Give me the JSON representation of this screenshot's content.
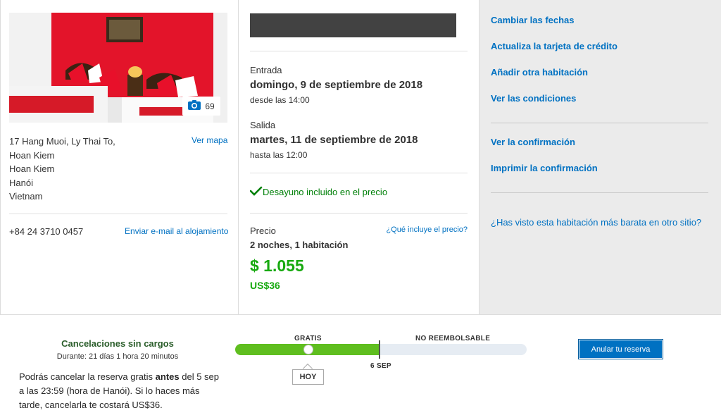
{
  "hotel": {
    "photo_count": "69",
    "address_lines": [
      "17 Hang Muoi, Ly Thai To,",
      "Hoan Kiem",
      "Hoan Kiem",
      "Hanói",
      "Vietnam"
    ],
    "map_link": "Ver mapa",
    "phone": "+84 24 3710 0457",
    "email_link": "Enviar e-mail al alojamiento"
  },
  "booking": {
    "checkin_label": "Entrada",
    "checkin_date": "domingo, 9 de septiembre de 2018",
    "checkin_time": "desde las 14:00",
    "checkout_label": "Salida",
    "checkout_date": "martes, 11 de septiembre de 2018",
    "checkout_time": "hasta las 12:00",
    "breakfast": "Desayuno incluido en el precio",
    "price_label": "Precio",
    "price_question": "¿Qué incluye el precio?",
    "stay_summary": "2 noches, 1 habitación",
    "price_local": "$ 1.055",
    "price_usd": "US$36"
  },
  "actions": {
    "change_dates": "Cambiar las fechas",
    "update_card": "Actualiza la tarjeta de crédito",
    "add_room": "Añadir otra habitación",
    "view_conditions": "Ver las condiciones",
    "view_confirmation": "Ver la confirmación",
    "print_confirmation": "Imprimir la confirmación",
    "cheaper_question": "¿Has visto esta habitación más barata en otro sitio?"
  },
  "cancellation": {
    "title": "Cancelaciones sin cargos",
    "duration": "Durante: 21 días 1 hora 20 minutos",
    "text_before": "Podrás cancelar la reserva gratis ",
    "text_bold": "antes",
    "text_after": " del 5 sep a las 23:59 (hora de Hanói). Si lo haces más tarde, cancelarla te costará US$36.",
    "free_label": "GRATIS",
    "nonrefundable_label": "NO REEMBOLSABLE",
    "deadline_label": "6 SEP",
    "today_label": "HOY",
    "cancel_button": "Anular tu reserva"
  },
  "colors": {
    "link": "#0071c2",
    "price_green": "#17a90f",
    "timeline_green": "#5fbe1f",
    "button_blue": "#0071c2"
  }
}
